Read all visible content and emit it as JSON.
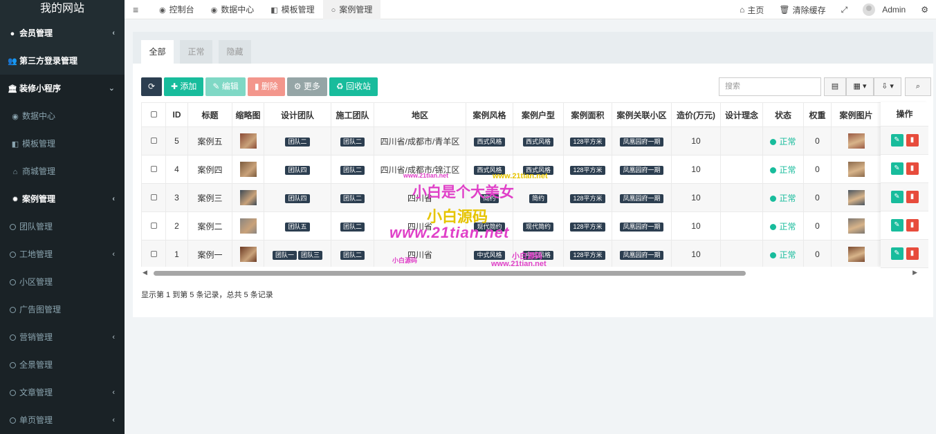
{
  "brand": "我的网站",
  "sidebar": {
    "items": [
      {
        "label": "会员管理",
        "icon": "user-circle-icon",
        "chevron": "‹"
      },
      {
        "label": "第三方登录管理",
        "icon": "users-icon",
        "chevron": ""
      },
      {
        "label": "装修小程序",
        "icon": "bank-icon",
        "chevron": "⌄"
      },
      {
        "label": "数据中心",
        "icon": "dashboard-icon",
        "chevron": ""
      },
      {
        "label": "模板管理",
        "icon": "cubes-icon",
        "chevron": ""
      },
      {
        "label": "商城管理",
        "icon": "home-icon",
        "chevron": ""
      },
      {
        "label": "案例管理",
        "icon": "gear-icon",
        "chevron": "‹"
      },
      {
        "label": "团队管理",
        "icon": "circle-icon",
        "chevron": ""
      },
      {
        "label": "工地管理",
        "icon": "circle-icon",
        "chevron": "‹"
      },
      {
        "label": "小区管理",
        "icon": "circle-icon",
        "chevron": ""
      },
      {
        "label": "广告图管理",
        "icon": "circle-icon",
        "chevron": ""
      },
      {
        "label": "营销管理",
        "icon": "circle-icon",
        "chevron": "‹"
      },
      {
        "label": "全景管理",
        "icon": "circle-icon",
        "chevron": ""
      },
      {
        "label": "文章管理",
        "icon": "circle-icon",
        "chevron": "‹"
      },
      {
        "label": "单页管理",
        "icon": "circle-icon",
        "chevron": "‹"
      }
    ]
  },
  "topnav": {
    "tabs": [
      {
        "label": "控制台",
        "icon": "dashboard-icon"
      },
      {
        "label": "数据中心",
        "icon": "dashboard-icon"
      },
      {
        "label": "模板管理",
        "icon": "cubes-icon"
      },
      {
        "label": "案例管理",
        "icon": "circle-icon"
      }
    ],
    "home": "主页",
    "clear_cache": "清除缓存",
    "user": "Admin"
  },
  "panel": {
    "tabs": [
      "全部",
      "正常",
      "隐藏"
    ],
    "toolbar": {
      "add": "添加",
      "edit": "编辑",
      "delete": "删除",
      "more": "更多",
      "recycle": "回收站"
    },
    "search_placeholder": "搜索",
    "columns": [
      "",
      "ID",
      "标题",
      "缩略图",
      "设计团队",
      "施工团队",
      "地区",
      "案例风格",
      "案例户型",
      "案例面积",
      "案例关联小区",
      "造价(万元)",
      "设计理念",
      "状态",
      "权重",
      "案例图片",
      ""
    ],
    "op_column": "操作",
    "rows": [
      {
        "id": "5",
        "title": "案例五",
        "design": [
          "团队二"
        ],
        "build": "团队二",
        "area": "四川省/成都市/青羊区",
        "style": "西式风格",
        "layout": "西式风格",
        "size": "128平方米",
        "community": "凤凰园府一期",
        "cost": "10",
        "idea": "",
        "status": "正常",
        "weight": "0",
        "thumb_color": "#8a4b36",
        "img_color": "#9a5a44"
      },
      {
        "id": "4",
        "title": "案例四",
        "design": [
          "团队四"
        ],
        "build": "团队二",
        "area": "四川省/成都市/锦江区",
        "style": "西式风格",
        "layout": "西式风格",
        "size": "128平方米",
        "community": "凤凰园府一期",
        "cost": "10",
        "idea": "",
        "status": "正常",
        "weight": "0",
        "thumb_color": "#7b5a3c",
        "img_color": "#8b6a4c"
      },
      {
        "id": "3",
        "title": "案例三",
        "design": [
          "团队四"
        ],
        "build": "团队二",
        "area": "四川省",
        "style": "简约",
        "layout": "简约",
        "size": "128平方米",
        "community": "凤凰园府一期",
        "cost": "10",
        "idea": "",
        "status": "正常",
        "weight": "0",
        "thumb_color": "#3d4a55",
        "img_color": "#4a5560"
      },
      {
        "id": "2",
        "title": "案例二",
        "design": [
          "团队五"
        ],
        "build": "团队二",
        "area": "四川省",
        "style": "现代简约",
        "layout": "现代简约",
        "size": "128平方米",
        "community": "凤凰园府一期",
        "cost": "10",
        "idea": "",
        "status": "正常",
        "weight": "0",
        "thumb_color": "#8a8580",
        "img_color": "#7d7770"
      },
      {
        "id": "1",
        "title": "案例一",
        "design": [
          "团队一",
          "团队三"
        ],
        "build": "团队二",
        "area": "四川省",
        "style": "中式风格",
        "layout": "中式风格",
        "size": "128平方米",
        "community": "凤凰园府一期",
        "cost": "10",
        "idea": "",
        "status": "正常",
        "weight": "0",
        "thumb_color": "#6b3a24",
        "img_color": "#7a4a30"
      }
    ],
    "pager_info": "显示第 1 到第 5 条记录，总共 5 条记录"
  },
  "watermarks": {
    "main": "小白是个大美女",
    "brand": "小白源码",
    "url": "www.21tian.net",
    "small_url": "www.21tian.net",
    "small_brand": "小白源码"
  },
  "colors": {
    "sidebar": "#222d32",
    "accent": "#18bc9c",
    "danger": "#e74c3c",
    "dark": "#2c3e50"
  }
}
